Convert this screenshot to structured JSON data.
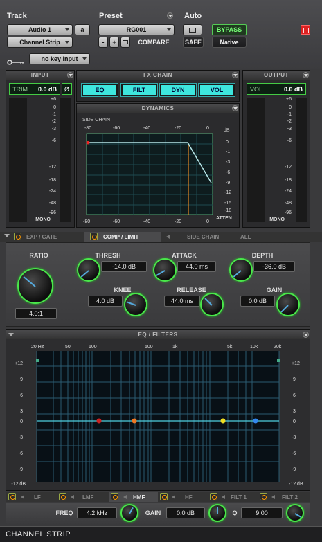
{
  "header": {
    "track_label": "Track",
    "preset_label": "Preset",
    "auto_label": "Auto",
    "track_name": "Audio 1",
    "track_letter": "a",
    "insert_name": "Channel Strip",
    "preset_name": "RG001",
    "minus": "-",
    "plus": "+",
    "compare": "COMPARE",
    "safe": "SAFE",
    "bypass": "BYPASS",
    "native": "Native",
    "key_input": "no key input"
  },
  "input": {
    "title": "INPUT",
    "trim_label": "TRIM",
    "trim_value": "0.0 dB",
    "phase": "Ø",
    "scale": [
      "+6",
      "0",
      "-1",
      "-2",
      "-3",
      "-6",
      "-12",
      "-18",
      "-24",
      "-48",
      "-96"
    ],
    "mono": "MONO"
  },
  "fx_chain": {
    "title": "FX CHAIN",
    "buttons": [
      "EQ",
      "FILT",
      "DYN",
      "VOL"
    ]
  },
  "output": {
    "title": "OUTPUT",
    "vol_label": "VOL",
    "vol_value": "0.0 dB",
    "scale": [
      "+6",
      "0",
      "-1",
      "-2",
      "-3",
      "-6",
      "-12",
      "-18",
      "-24",
      "-48",
      "-96"
    ],
    "mono": "MONO"
  },
  "dynamics": {
    "title": "DYNAMICS",
    "side_chain": "SIDE CHAIN",
    "top_ticks": [
      "-80",
      "-60",
      "-40",
      "-20",
      "0"
    ],
    "bottom_ticks": [
      "-80",
      "-60",
      "-40",
      "-20",
      "0"
    ],
    "db": "dB",
    "right_ticks": [
      "0",
      "-1",
      "-3",
      "-6",
      "-9",
      "-12",
      "-15",
      "-18"
    ],
    "atten": "ATTEN"
  },
  "tabs": {
    "exp_gate": "EXP / GATE",
    "comp_limit": "COMP / LIMIT",
    "side_chain": "SIDE CHAIN",
    "all": "ALL"
  },
  "comp": {
    "ratio_label": "RATIO",
    "ratio_value": "4.0:1",
    "thresh_label": "THRESH",
    "thresh_value": "-14.0 dB",
    "knee_label": "KNEE",
    "knee_value": "4.0 dB",
    "attack_label": "ATTACK",
    "attack_value": "44.0 ms",
    "release_label": "RELEASE",
    "release_value": "44.0 ms",
    "depth_label": "DEPTH",
    "depth_value": "-36.0 dB",
    "gain_label": "GAIN",
    "gain_value": "0.0 dB"
  },
  "eq": {
    "title": "EQ / FILTERS",
    "freq_ticks": [
      "20 Hz",
      "50",
      "100",
      "500",
      "1k",
      "5k",
      "10k",
      "20k"
    ],
    "db_ticks_left": [
      "+12",
      "9",
      "6",
      "3",
      "0",
      "-3",
      "-6",
      "-9",
      "-12 dB"
    ],
    "db_ticks_right": [
      "+12",
      "9",
      "6",
      "3",
      "0",
      "-3",
      "-6",
      "-9",
      "-12 dB"
    ],
    "bands": [
      "LF",
      "LMF",
      "HMF",
      "HF",
      "FILT 1",
      "FILT 2"
    ],
    "freq_label": "FREQ",
    "freq_value": "4.2 kHz",
    "gain_label": "GAIN",
    "gain_value": "0.0 dB",
    "q_label": "Q",
    "q_value": "9.00",
    "band_colors": {
      "lf": "#cc2222",
      "lmf": "#ee7722",
      "hmf": "#eedd22",
      "hf": "#3388ee"
    }
  },
  "footer": {
    "title": "CHANNEL STRIP"
  }
}
